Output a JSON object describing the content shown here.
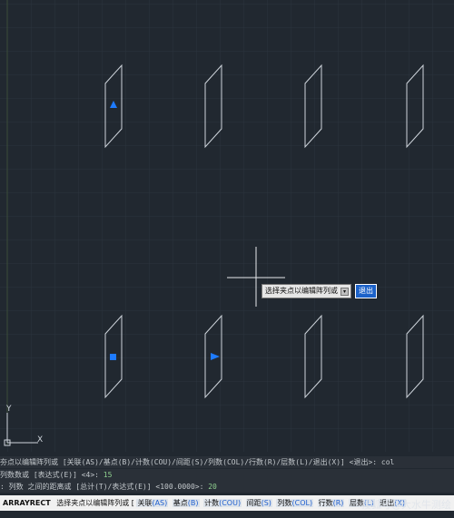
{
  "drawing": {
    "background": "#212830",
    "line_color": "#cfd5dc",
    "grip_color": "#1e7bff"
  },
  "history": {
    "line1": "夯点以编辑阵列或 [关联(AS)/基点(B)/计数(COU)/间距(S)/列数(COL)/行数(R)/层数(L)/退出(X)] <退出>: col",
    "line2_prefix": "列数数或 [表达式(E)] <4>: ",
    "line2_value": "15",
    "line3_prefix": ": 列数 之间的距离或 [总计(T)/表达式(E)] <100.0000>: ",
    "line3_value": "20"
  },
  "command": {
    "name": "ARRAYRECT",
    "prompt": "选择夹点以编辑阵列或",
    "bracket_open": "[",
    "options": [
      {
        "label": "关联",
        "key": "(AS)"
      },
      {
        "label": "基点",
        "key": "(B)"
      },
      {
        "label": "计数",
        "key": "(COU)"
      },
      {
        "label": "间距",
        "key": "(S)"
      },
      {
        "label": "列数",
        "key": "(COL)"
      },
      {
        "label": "行数",
        "key": "(R)"
      },
      {
        "label": "层数",
        "key": "(L)"
      },
      {
        "label": "退出",
        "key": "(X)"
      }
    ]
  },
  "tooltip": {
    "text": "选择夹点以编辑阵列或",
    "exit_label": "退出"
  },
  "ucs": {
    "y_label": "Y",
    "x_label": "X"
  },
  "watermark": "搜狐号@大水牛测绘"
}
